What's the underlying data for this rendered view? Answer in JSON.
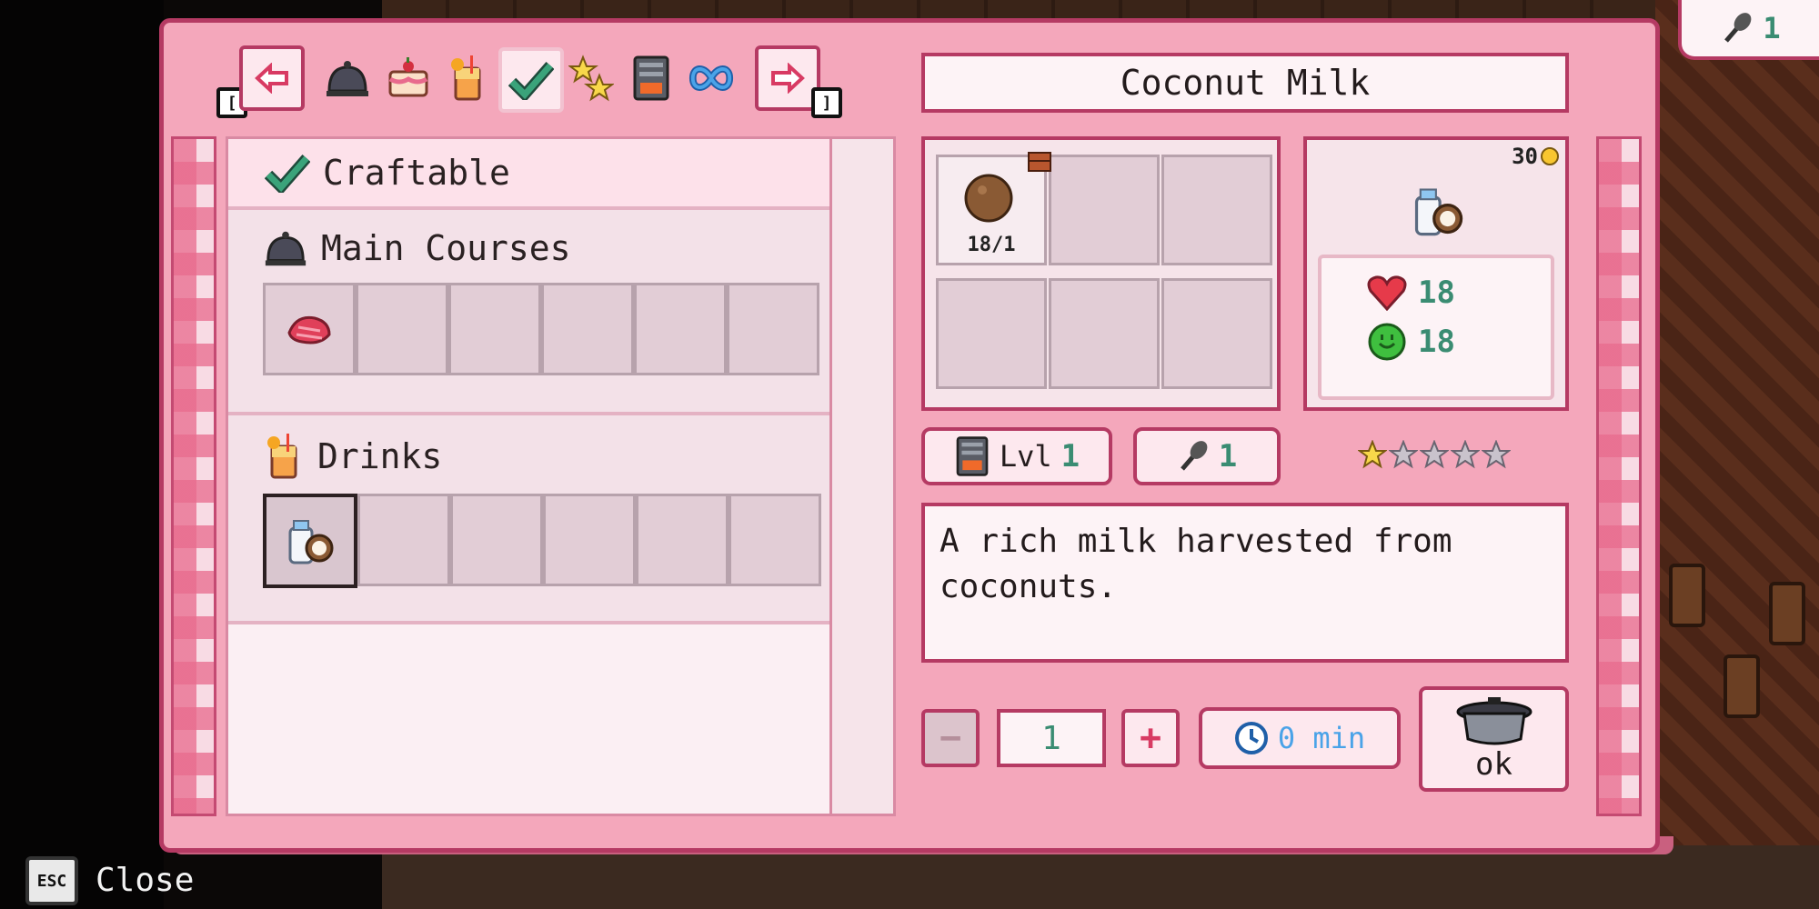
{
  "recipe": {
    "name": "Coconut Milk",
    "description": "A rich milk harvested from coconuts.",
    "price": "30",
    "level_label": "Lvl",
    "level": "1",
    "skill_points": "1",
    "stars": 1,
    "stars_max": 5,
    "health": "18",
    "energy": "18",
    "ingredient_count": "18/1"
  },
  "tabs": [
    {
      "name": "prev",
      "icon": "arrow-left-icon",
      "key": "["
    },
    {
      "name": "main-courses",
      "icon": "cloche-icon"
    },
    {
      "name": "desserts",
      "icon": "cake-icon"
    },
    {
      "name": "drinks",
      "icon": "drink-icon"
    },
    {
      "name": "craftable",
      "icon": "checkmark-icon",
      "selected": true
    },
    {
      "name": "special",
      "icon": "stars-icon"
    },
    {
      "name": "appliances",
      "icon": "oven-icon"
    },
    {
      "name": "all",
      "icon": "infinity-icon"
    },
    {
      "name": "next",
      "icon": "arrow-right-icon",
      "key": "]"
    }
  ],
  "list": {
    "header": "Craftable",
    "categories": [
      {
        "label": "Main Courses",
        "icon": "cloche-icon"
      },
      {
        "label": "Drinks",
        "icon": "drink-icon"
      }
    ]
  },
  "quantity": {
    "value": "1",
    "minus": "−",
    "plus": "+"
  },
  "time": "0 min",
  "ok_label": "ok",
  "footer": {
    "key": "ESC",
    "label": "Close"
  },
  "corner": {
    "value": "1"
  },
  "colors": {
    "panel": "#f4a7bb",
    "border": "#b53a63",
    "accent_green": "#3a8c72",
    "check_green": "#3aa37a"
  }
}
